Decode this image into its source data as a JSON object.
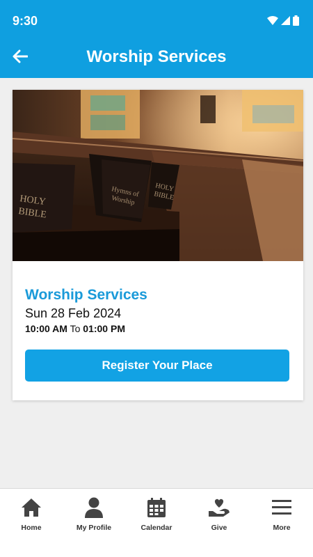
{
  "status_bar": {
    "time": "9:30",
    "icons": [
      "wifi-icon",
      "signal-icon",
      "battery-icon"
    ]
  },
  "app_bar": {
    "title": "Worship Services",
    "back_icon": "arrow-left-icon"
  },
  "event": {
    "title": "Worship Services",
    "date": "Sun 28 Feb 2024",
    "start_time": "10:00 AM",
    "time_separator": "To",
    "end_time": "01:00 PM",
    "register_label": "Register Your Place"
  },
  "bottom_nav": {
    "items": [
      {
        "label": "Home",
        "icon": "home-icon"
      },
      {
        "label": "My Profile",
        "icon": "person-icon"
      },
      {
        "label": "Calendar",
        "icon": "calendar-icon"
      },
      {
        "label": "Give",
        "icon": "heart-hand-icon"
      },
      {
        "label": "More",
        "icon": "menu-icon"
      }
    ]
  },
  "colors": {
    "primary": "#0f9fe0",
    "title_text": "#1a9ad9",
    "background": "#efefef",
    "nav_icon": "#444444"
  }
}
